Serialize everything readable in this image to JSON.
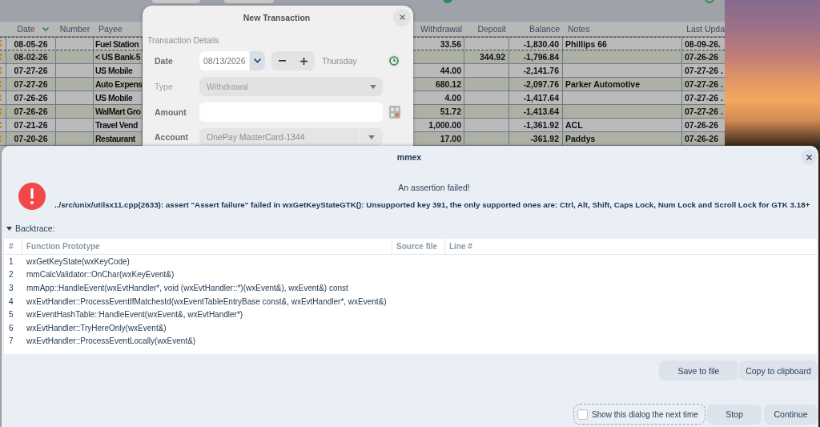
{
  "app_window": {
    "table": {
      "columns": [
        {
          "label": "Date",
          "sorted": true
        },
        {
          "label": "Number",
          "sorted": false
        },
        {
          "label": "Payee",
          "sorted": false
        },
        {
          "label": "Withdrawal",
          "sorted": false
        },
        {
          "label": "Deposit",
          "sorted": false
        },
        {
          "label": "Balance",
          "sorted": false
        },
        {
          "label": "Notes",
          "sorted": false
        },
        {
          "label": "Last Upda",
          "sorted": false
        }
      ],
      "rows": [
        {
          "selected": true,
          "date": "08-05-26",
          "payee": "Fuel Station",
          "withdrawal": "33.56",
          "balance": "-1,830.40",
          "notes": "Phillips 66",
          "column_9": "08-09-26."
        },
        {
          "selected": false,
          "date": "08-02-26",
          "payee": "< US Bank-5",
          "deposit": "344.92",
          "balance": "-1,796.84",
          "column_9": "07-26-26"
        },
        {
          "selected": false,
          "date": "07-27-26",
          "payee": "US Mobile",
          "withdrawal": "44.00",
          "balance": "-2,141.76",
          "column_9": "07-27-26 ."
        },
        {
          "selected": false,
          "date": "07-27-26",
          "payee": "Auto Expens",
          "withdrawal": "680.12",
          "balance": "-2,097.76",
          "notes": "Parker Automotive",
          "column_9": "07-27-26 ."
        },
        {
          "selected": false,
          "date": "07-26-26",
          "payee": "US Mobile",
          "withdrawal": "4.00",
          "balance": "-1,417.64",
          "column_9": "07-27-26 ."
        },
        {
          "selected": false,
          "date": "07-26-26",
          "payee": "WalMart Gro",
          "withdrawal": "51.72",
          "balance": "-1,413.64",
          "column_9": "07-27-26 ."
        },
        {
          "selected": false,
          "date": "07-21-26",
          "payee": "Travel Vend",
          "withdrawal": "1,000.00",
          "balance": "-1,361.92",
          "notes": "ACL",
          "column_9": "07-26-26"
        },
        {
          "selected": false,
          "date": "07-20-26",
          "payee": "Restaurant",
          "withdrawal": "17.00",
          "balance": "-361.92",
          "notes": "Paddys",
          "column_9": "07-26-26"
        }
      ]
    }
  },
  "new_transaction_dialog": {
    "title": "New Transaction",
    "section": "Transaction Details",
    "date": {
      "label": "Date",
      "value": "08/13/2026",
      "weekday": "Thursday"
    },
    "type": {
      "label": "Type",
      "value": "Withdrawal",
      "disabled": true
    },
    "amount": {
      "label": "Amount"
    },
    "account": {
      "label": "Account",
      "value": "OnePay MasterCard-1344"
    }
  },
  "assert_dialog": {
    "title": "mmex",
    "heading": "An assertion failed!",
    "message": "../src/unix/utilsx11.cpp(2633): assert \"Assert failure\" failed in wxGetKeyStateGTK(): Unsupported key 391, the only supported ones are: Ctrl, Alt, Shift, Caps Lock, Num Lock and Scroll Lock for GTK 3.18+",
    "backtrace": {
      "label": "Backtrace:",
      "expanded": true,
      "columns": [
        "#",
        "Function Prototype",
        "Source file",
        "Line #"
      ],
      "rows": [
        {
          "number": "1",
          "function": "wxGetKeyState(wxKeyCode)"
        },
        {
          "number": "2",
          "function": "mmCalcValidator::OnChar(wxKeyEvent&)"
        },
        {
          "number": "3",
          "function": "mmApp::HandleEvent(wxEvtHandler*, void (wxEvtHandler::*)(wxEvent&), wxEvent&) const"
        },
        {
          "number": "4",
          "function": "wxEvtHandler::ProcessEventIfMatchesId(wxEventTableEntryBase const&, wxEvtHandler*, wxEvent&)"
        },
        {
          "number": "5",
          "function": "wxEventHashTable::HandleEvent(wxEvent&, wxEvtHandler*)"
        },
        {
          "number": "6",
          "function": "wxEvtHandler::TryHereOnly(wxEvent&)"
        },
        {
          "number": "7",
          "function": "wxEvtHandler::ProcessEventLocally(wxEvent&)"
        }
      ]
    },
    "file_buttons": [
      "Save to file",
      "Copy to clipboard"
    ],
    "show_again": {
      "label": "Show this dialog the next time",
      "checked": false
    },
    "actions": [
      "Stop",
      "Continue"
    ]
  }
}
